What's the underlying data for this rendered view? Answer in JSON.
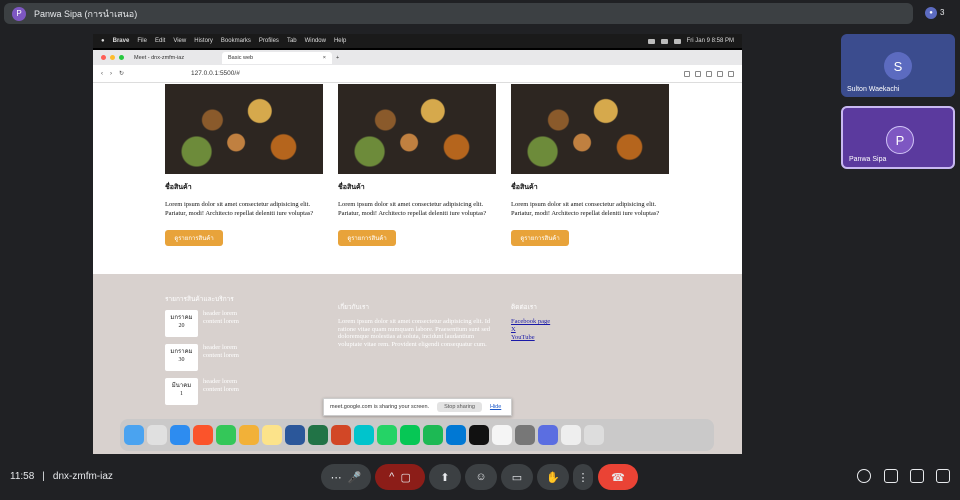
{
  "meet": {
    "presenter_initial": "P",
    "presenter_text": "Panwa Sipa (การนำเสนอ)",
    "participant_count": "3",
    "participants": [
      {
        "initial": "S",
        "name": "Sulton Waekachi"
      },
      {
        "initial": "P",
        "name": "Panwa Sipa"
      }
    ],
    "time": "11:58",
    "meeting_code": "dnx-zmfm-iaz"
  },
  "mac": {
    "brand": "Brave",
    "menus": [
      "File",
      "Edit",
      "View",
      "History",
      "Bookmarks",
      "Profiles",
      "Tab",
      "Window",
      "Help"
    ],
    "datetime": "Fri Jan 9  8:58 PM"
  },
  "browser": {
    "tabs": [
      {
        "label": "Meet - dnx-zmfm-iaz"
      },
      {
        "label": "Basic web"
      }
    ],
    "new_tab": "+",
    "url": "127.0.0.1:5500/#"
  },
  "page": {
    "products": [
      {
        "name": "ชื่อสินค้า",
        "desc": "Lorem ipsum dolor sit amet consectetur adipisicing elit. Pariatur, modi! Architecto repellat deleniti iure voluptas?",
        "button": "ดูรายการสินค้า"
      },
      {
        "name": "ชื่อสินค้า",
        "desc": "Lorem ipsum dolor sit amet consectetur adipisicing elit. Pariatur, modi! Architecto repellat deleniti iure voluptas?",
        "button": "ดูรายการสินค้า"
      },
      {
        "name": "ชื่อสินค้า",
        "desc": "Lorem ipsum dolor sit amet consectetur adipisicing elit. Pariatur, modi! Architecto repellat deleniti iure voluptas?",
        "button": "ดูรายการสินค้า"
      }
    ],
    "footer": {
      "events_title": "รายการสินค้าและบริการ",
      "events": [
        {
          "month": "มกราคม",
          "day": "20",
          "header": "header lorem",
          "content": "content lorem"
        },
        {
          "month": "มกราคม",
          "day": "30",
          "header": "header lorem",
          "content": "content lorem"
        },
        {
          "month": "มีนาคม",
          "day": "1",
          "header": "header lorem",
          "content": "content lorem"
        }
      ],
      "about_title": "เกี่ยวกับเรา",
      "about_text": "Lorem ipsum dolor sit amet consectetur adipisicing elit. Id ratione vitae quam numquam labore. Praesentium sunt sed doloremque molestias at soluta, incidunt laudantium voluptate vitae rem. Provident eligendi consequatur cum.",
      "contact_title": "ติดต่อเรา",
      "links": [
        "Facebook page",
        "X",
        "YouTube"
      ]
    }
  },
  "share_notice": {
    "text": "meet.google.com is sharing your screen.",
    "stop": "Stop sharing",
    "hide": "Hide"
  }
}
